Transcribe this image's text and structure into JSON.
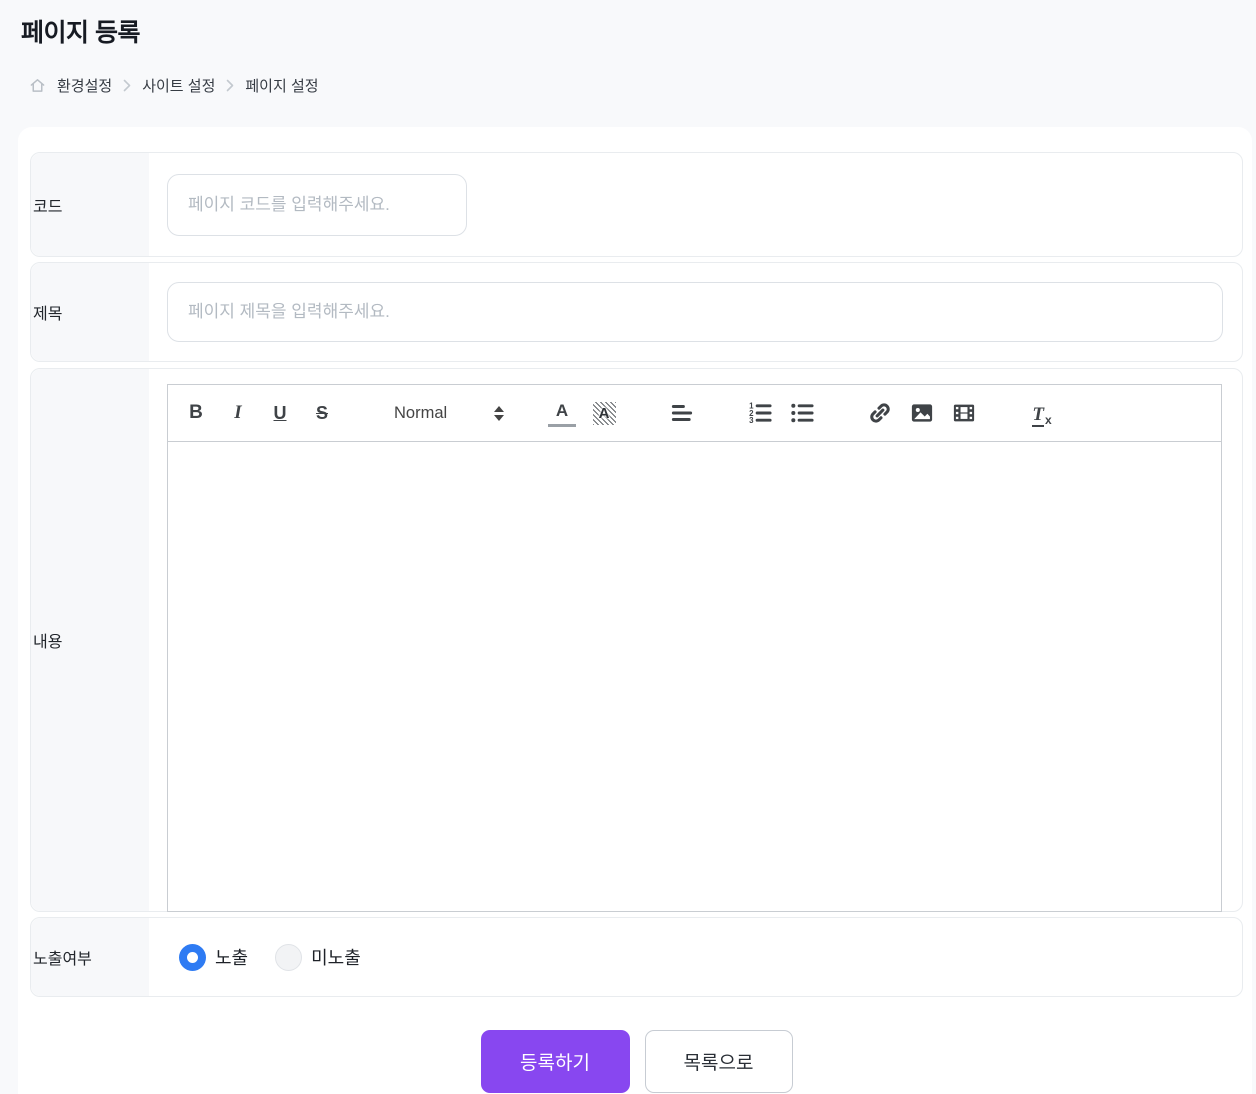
{
  "header": {
    "title": "페이지 등록"
  },
  "breadcrumb": {
    "items": [
      {
        "label": "환경설정"
      },
      {
        "label": "사이트 설정"
      },
      {
        "label": "페이지 설정"
      }
    ]
  },
  "form": {
    "code": {
      "label": "코드",
      "placeholder": "페이지 코드를 입력해주세요.",
      "value": ""
    },
    "title": {
      "label": "제목",
      "placeholder": "페이지 제목을 입력해주세요.",
      "value": ""
    },
    "content": {
      "label": "내용",
      "value": ""
    },
    "visibility": {
      "label": "노출여부",
      "selected": "노출",
      "options": [
        {
          "label": "노출",
          "checked": true
        },
        {
          "label": "미노출",
          "checked": false
        }
      ]
    }
  },
  "editor": {
    "toolbar": {
      "bold": "B",
      "italic": "I",
      "underline": "U",
      "strike": "S",
      "format": "Normal",
      "color_letter": "A",
      "background_letter": "A",
      "clean_main": "T",
      "clean_sub": "x"
    },
    "icons": [
      "bold",
      "italic",
      "underline",
      "strike",
      "format-select",
      "text-color",
      "background-color",
      "align",
      "ordered-list",
      "bullet-list",
      "link",
      "image",
      "video",
      "clean-format"
    ]
  },
  "actions": {
    "submit": "등록하기",
    "back": "목록으로"
  },
  "colors": {
    "accent_purple": "#8847f0",
    "radio_blue": "#2e7bf3",
    "page_background": "#f8f9fb",
    "row_border": "#e9ecef",
    "label_background": "#f7f8fa"
  }
}
